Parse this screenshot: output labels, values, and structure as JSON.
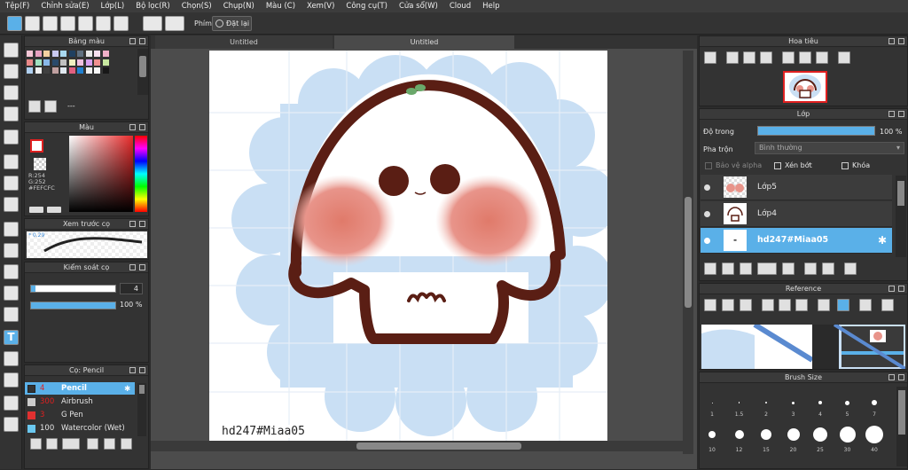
{
  "menu": [
    "Tệp(F)",
    "Chỉnh sửa(E)",
    "Lớp(L)",
    "Bộ lọc(R)",
    "Chọn(S)",
    "Chụp(N)",
    "Màu (C)",
    "Xem(V)",
    "Công cụ(T)",
    "Cửa sổ(W)",
    "Cloud",
    "Help"
  ],
  "toolbar": {
    "phim": "Phím",
    "reset": "Đặt lại"
  },
  "tabs": [
    "Untitled",
    "Untitled"
  ],
  "panels": {
    "palette": "Bảng màu",
    "color": "Màu",
    "brush_preview": "Xem trước cọ",
    "brush_control": "Kiểm soát cọ",
    "brush_list": "Cọ: Pencil",
    "navigator": "Hoa tiêu",
    "layer": "Lớp",
    "reference": "Reference",
    "brush_size": "Brush Size"
  },
  "palette_more": "---",
  "color_info": {
    "r": "R:254",
    "g": "G:252",
    "hex": "#FEFCFC"
  },
  "brush_preview_val": "0.29",
  "brush_control": {
    "size": "4",
    "opacity": "100 %"
  },
  "brushes": [
    {
      "size": "4",
      "name": "Pencil",
      "color": "#333"
    },
    {
      "size": "300",
      "name": "Airbrush",
      "color": "#ccc"
    },
    {
      "size": "3",
      "name": "G Pen",
      "color": "#e03030"
    },
    {
      "size": "100",
      "name": "Watercolor (Wet)",
      "color": "#6ac8f0"
    }
  ],
  "layer_panel": {
    "opacity_label": "Độ trong",
    "opacity_value": "100 %",
    "blend_label": "Pha trộn",
    "blend_value": "Bình thường",
    "protect_alpha": "Bảo vệ alpha",
    "clip": "Xén bớt",
    "lock": "Khóa"
  },
  "layers": [
    "Lớp5",
    "Lớp4",
    "hd247#Miaa05"
  ],
  "canvas_signature": "hd247#Miaa05",
  "brush_sizes": [
    "1",
    "1.5",
    "2",
    "3",
    "4",
    "5",
    "7",
    "10",
    "12",
    "15",
    "20",
    "25",
    "30",
    "40"
  ],
  "colors": {
    "accent": "#5ab0e8",
    "bg": "#2b2b2b",
    "blush": "#e07a6a",
    "outline": "#5a1e14",
    "cloud": "#c9dff4"
  }
}
